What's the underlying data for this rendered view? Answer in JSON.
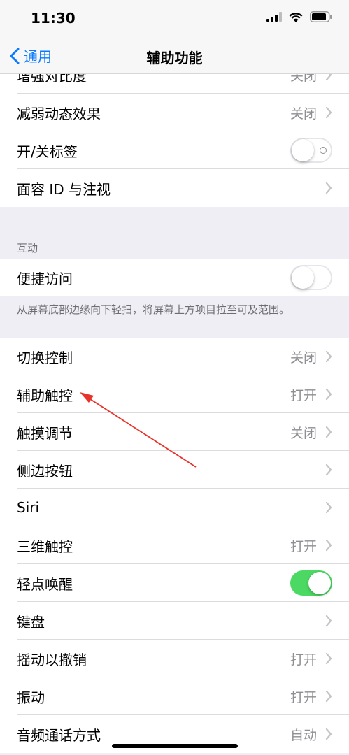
{
  "status": {
    "time": "11:30"
  },
  "nav": {
    "back_label": "通用",
    "title": "辅助功能"
  },
  "top_items": [
    {
      "label": "增强对比度",
      "value": "关闭"
    },
    {
      "label": "减弱动态效果",
      "value": "关闭"
    },
    {
      "label": "开/关标签",
      "toggle": "off"
    },
    {
      "label": "面容 ID 与注视",
      "value": ""
    }
  ],
  "interaction": {
    "section_label": "互动",
    "reachability": {
      "label": "便捷访问",
      "toggle": "off"
    },
    "footnote": "从屏幕底部边缘向下轻扫，将屏幕上方项目拉至可及范围。"
  },
  "items": [
    {
      "label": "切换控制",
      "value": "关闭"
    },
    {
      "label": "辅助触控",
      "value": "打开"
    },
    {
      "label": "触摸调节",
      "value": "关闭"
    },
    {
      "label": "侧边按钮",
      "value": ""
    },
    {
      "label": "Siri",
      "value": ""
    },
    {
      "label": "三维触控",
      "value": "打开"
    },
    {
      "label": "轻点唤醒",
      "toggle": "on"
    },
    {
      "label": "键盘",
      "value": ""
    },
    {
      "label": "摇动以撤销",
      "value": "打开"
    },
    {
      "label": "振动",
      "value": "打开"
    },
    {
      "label": "音频通话方式",
      "value": "自动"
    }
  ],
  "colors": {
    "accent": "#0a7aff",
    "toggle_on": "#4bd963",
    "annotation_arrow": "#e8332a"
  }
}
